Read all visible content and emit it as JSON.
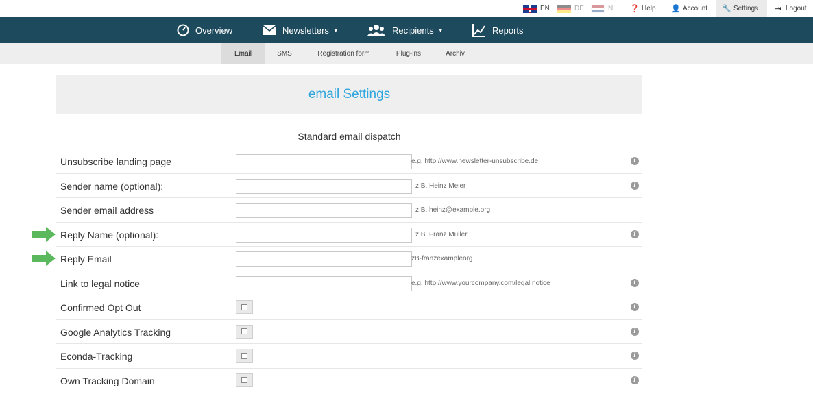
{
  "topbar": {
    "languages": [
      {
        "code": "EN",
        "flag": "uk-flag-icon",
        "active": true
      },
      {
        "code": "DE",
        "flag": "germany-flag-icon",
        "active": false
      },
      {
        "code": "NL",
        "flag": "netherlands-flag-icon",
        "active": false
      }
    ],
    "help": "Help",
    "account": "Account",
    "settings": "Settings",
    "logout": "Logout"
  },
  "mainnav": {
    "overview": "Overview",
    "newsletters": "Newsletters",
    "recipients": "Recipients",
    "reports": "Reports"
  },
  "subnav": {
    "tabs": [
      "Email",
      "SMS",
      "Registration form",
      "Plug-ins",
      "Archiv"
    ],
    "active": "Email"
  },
  "page": {
    "title": "email Settings",
    "section": "Standard email dispatch"
  },
  "fields": [
    {
      "label": "Unsubscribe landing page",
      "value": "",
      "hint": "e.g. http://www.newsletter-unsubscribe.de",
      "info": true
    },
    {
      "label": "Sender name (optional):",
      "value": "",
      "hint": "z.B. Heinz Meier",
      "info": true
    },
    {
      "label": "Sender email address",
      "value": "",
      "hint": "z.B. heinz@example.org",
      "info": false
    },
    {
      "label": "Reply Name (optional):",
      "value": "",
      "hint": "z.B. Franz Müller",
      "info": true
    },
    {
      "label": "Reply Email",
      "value": "",
      "hint": "zB-franzexampleorg",
      "info": false
    },
    {
      "label": "Link to legal notice",
      "value": "",
      "hint": "e.g. http://www.yourcompany.com/legal notice",
      "info": true
    }
  ],
  "checkboxes": [
    {
      "label": "Confirmed Opt Out",
      "checked": false
    },
    {
      "label": "Google Analytics Tracking",
      "checked": false
    },
    {
      "label": "Econda-Tracking",
      "checked": false
    },
    {
      "label": "Own Tracking Domain",
      "checked": false
    }
  ],
  "colors": {
    "nav_bg": "#1e4a5e",
    "title": "#2fa6dd",
    "arrow": "#5cb85c"
  }
}
